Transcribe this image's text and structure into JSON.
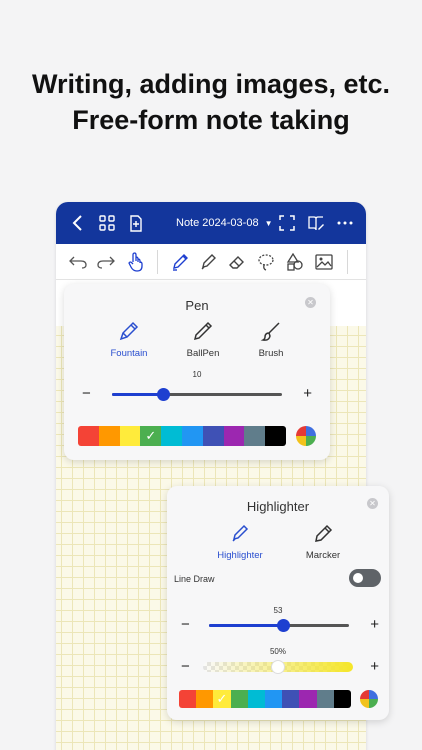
{
  "headline": {
    "line1": "Writing, adding images, etc.",
    "line2": "Free-form note taking"
  },
  "topbar": {
    "title": "Note 2024-03-08",
    "bg": "#13369c",
    "icons": [
      "back-icon",
      "grid-icon",
      "add-page-icon",
      "fullscreen-icon",
      "book-edit-icon",
      "more-icon"
    ]
  },
  "toolbar": {
    "icons": [
      "undo-icon",
      "redo-icon",
      "hand-icon",
      "pen-icon",
      "highlighter-icon",
      "eraser-icon",
      "lasso-icon",
      "shapes-icon",
      "image-icon"
    ]
  },
  "pen_popup": {
    "title": "Pen",
    "types": [
      {
        "label": "Fountain",
        "active": true
      },
      {
        "label": "BallPen",
        "active": false
      },
      {
        "label": "Brush",
        "active": false
      }
    ],
    "size_value": "10",
    "size_fraction": 0.3,
    "minus": "−",
    "plus": "+",
    "colors": [
      "#f44336",
      "#ff9800",
      "#ffeb3b",
      "#4caf50",
      "#00bcd4",
      "#2196f3",
      "#3f51b5",
      "#9c27b0",
      "#607d8b",
      "#000000"
    ],
    "selected_color_index": 3
  },
  "highlighter_popup": {
    "title": "Highlighter",
    "types": [
      {
        "label": "Highlighter",
        "active": true
      },
      {
        "label": "Marcker",
        "active": false
      }
    ],
    "line_draw_label": "Line Draw",
    "line_draw_on": false,
    "size_value": "53",
    "size_fraction": 0.53,
    "opacity_value": "50%",
    "opacity_fraction": 0.5,
    "minus": "−",
    "plus": "+",
    "colors": [
      "#f44336",
      "#ff9800",
      "#ffeb3b",
      "#4caf50",
      "#00bcd4",
      "#2196f3",
      "#3f51b5",
      "#9c27b0",
      "#607d8b",
      "#000000"
    ],
    "selected_color_index": 2
  },
  "accent": "#1e3fd0"
}
